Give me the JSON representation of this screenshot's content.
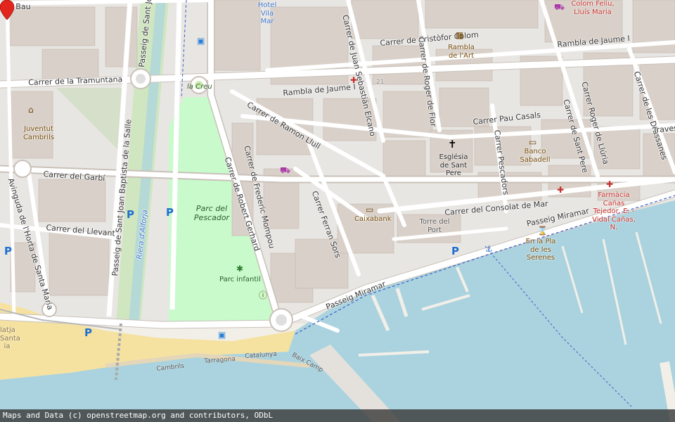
{
  "streets": [
    {
      "text": "del Bau"
    },
    {
      "text": "Passeig de Sant Jo"
    },
    {
      "text": "Carrer de la Tramuntana"
    },
    {
      "text": "Carrer del Garbí"
    },
    {
      "text": "Carrer del Llevant"
    },
    {
      "text": "Avinguda de l'Horta de Santa Maria"
    },
    {
      "text": "Passeig de Sant Joan Baptista de la Salle"
    },
    {
      "text": "Carrer de Robert Gerhard"
    },
    {
      "text": "Carrer de Frederic Mompou"
    },
    {
      "text": "Carrer de Ramon Llull"
    },
    {
      "text": "Carrer Ferran Sors"
    },
    {
      "text": "Carrer de Juan Sebastián Elcano"
    },
    {
      "text": "Carrer de Cristòfor Colom"
    },
    {
      "text": "Rambla de Jaume I"
    },
    {
      "text": "Rambla de Jaume I"
    },
    {
      "text": "Carrer de Roger de Flor"
    },
    {
      "text": "Carrer Pau Casals"
    },
    {
      "text": "Carrer Pescadors"
    },
    {
      "text": "Carrer de Sant Pere"
    },
    {
      "text": "Carrer Roger de Llúria"
    },
    {
      "text": "Carrer de les Drassanes"
    },
    {
      "text": "Traves"
    },
    {
      "text": "Carrer del Consolat de Mar"
    },
    {
      "text": "Passeig Miramar"
    },
    {
      "text": "Passeig Miramar"
    },
    {
      "text": "Riera d'Alforja"
    }
  ],
  "places": {
    "hotel": "Hotel Vila Mar",
    "colom": "Colom Feliu, Lluís Maria",
    "rambla_art": "Rambla de l'Art",
    "la_creu": "la Creu",
    "juventut": "Juventut Cambrils",
    "parc_pescador": "Parc del Pescador",
    "parc_infantil": "Parc infantil",
    "esglesia": "Església de Sant Pere",
    "banco": "Banco Sabadell",
    "caixabank": "Caixabank",
    "torre": "Torre del Port",
    "pla_serenes": "En la Pla de les Serenes",
    "farmacia": "Farmàcia Cañas Tejedor, E. - Vidal Cañas, N.",
    "number_21": "21"
  },
  "coast_labels": [
    "Cambrils",
    "Tarragona",
    "Catalunya",
    "Baix Camp"
  ],
  "beach_label": "latja Santa ia",
  "attribution": "Maps and Data (c) openstreetmap.org and contributors, ODbL",
  "colors": {
    "land": "#f2efe9",
    "water": "#aad3df",
    "park": "#c8facc",
    "building": "#d9d0c9",
    "beach": "#f5e2a1",
    "road": "#ffffff",
    "marker": "#e2261d"
  },
  "icons": [
    "marker-icon",
    "parking-icon",
    "bus-stop-icon",
    "pharmacy-icon",
    "church-icon",
    "bank-icon",
    "cinema-icon",
    "shop-icon",
    "monument-icon",
    "info-icon",
    "playground-icon",
    "anchor-icon"
  ]
}
